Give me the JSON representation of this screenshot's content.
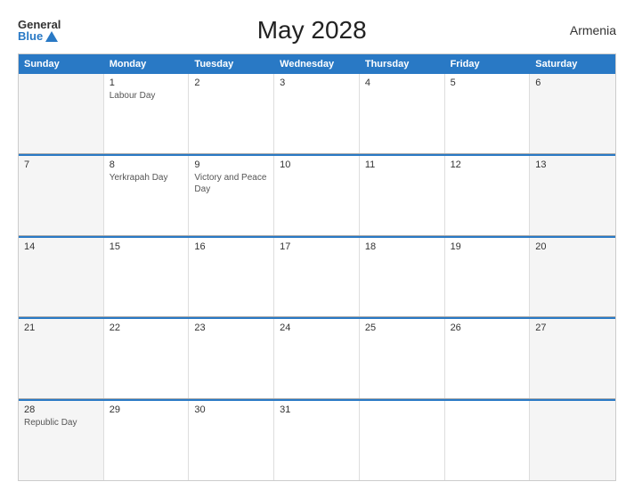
{
  "logo": {
    "general": "General",
    "blue": "Blue"
  },
  "title": "May 2028",
  "country": "Armenia",
  "days_header": [
    "Sunday",
    "Monday",
    "Tuesday",
    "Wednesday",
    "Thursday",
    "Friday",
    "Saturday"
  ],
  "weeks": [
    [
      {
        "day": "",
        "holiday": ""
      },
      {
        "day": "1",
        "holiday": "Labour Day"
      },
      {
        "day": "2",
        "holiday": ""
      },
      {
        "day": "3",
        "holiday": ""
      },
      {
        "day": "4",
        "holiday": ""
      },
      {
        "day": "5",
        "holiday": ""
      },
      {
        "day": "6",
        "holiday": ""
      }
    ],
    [
      {
        "day": "7",
        "holiday": ""
      },
      {
        "day": "8",
        "holiday": "Yerkrapah Day"
      },
      {
        "day": "9",
        "holiday": "Victory and Peace Day"
      },
      {
        "day": "10",
        "holiday": ""
      },
      {
        "day": "11",
        "holiday": ""
      },
      {
        "day": "12",
        "holiday": ""
      },
      {
        "day": "13",
        "holiday": ""
      }
    ],
    [
      {
        "day": "14",
        "holiday": ""
      },
      {
        "day": "15",
        "holiday": ""
      },
      {
        "day": "16",
        "holiday": ""
      },
      {
        "day": "17",
        "holiday": ""
      },
      {
        "day": "18",
        "holiday": ""
      },
      {
        "day": "19",
        "holiday": ""
      },
      {
        "day": "20",
        "holiday": ""
      }
    ],
    [
      {
        "day": "21",
        "holiday": ""
      },
      {
        "day": "22",
        "holiday": ""
      },
      {
        "day": "23",
        "holiday": ""
      },
      {
        "day": "24",
        "holiday": ""
      },
      {
        "day": "25",
        "holiday": ""
      },
      {
        "day": "26",
        "holiday": ""
      },
      {
        "day": "27",
        "holiday": ""
      }
    ],
    [
      {
        "day": "28",
        "holiday": "Republic Day"
      },
      {
        "day": "29",
        "holiday": ""
      },
      {
        "day": "30",
        "holiday": ""
      },
      {
        "day": "31",
        "holiday": ""
      },
      {
        "day": "",
        "holiday": ""
      },
      {
        "day": "",
        "holiday": ""
      },
      {
        "day": "",
        "holiday": ""
      }
    ]
  ]
}
